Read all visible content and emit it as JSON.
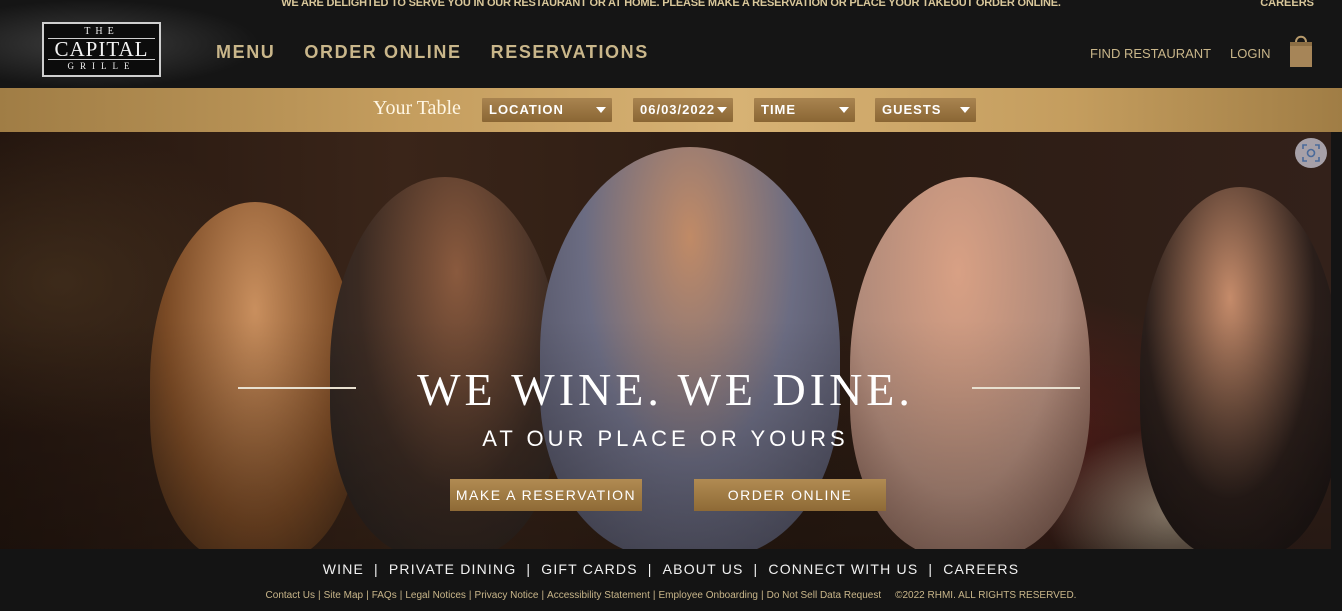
{
  "announcement": "WE ARE DELIGHTED TO SERVE YOU IN OUR RESTAURANT OR AT HOME. PLEASE MAKE A RESERVATION OR PLACE YOUR TAKEOUT ORDER ONLINE.",
  "top_careers": "CAREERS",
  "logo": {
    "the": "THE",
    "capital": "CAPITAL",
    "grille": "GRILLE"
  },
  "nav": [
    {
      "label": "MENU"
    },
    {
      "label": "ORDER ONLINE"
    },
    {
      "label": "RESERVATIONS"
    }
  ],
  "header_links": {
    "find": "FIND RESTAURANT",
    "login": "LOGIN",
    "bag_icon": "shopping-bag-icon"
  },
  "reservation": {
    "title": "Your Table",
    "location": "LOCATION",
    "date": "06/03/2022",
    "time": "TIME",
    "guests": "GUESTS"
  },
  "hero": {
    "headline": "WE WINE. WE DINE.",
    "subhead": "AT OUR PLACE OR YOURS",
    "btn_reserve": "MAKE A RESERVATION",
    "btn_order": "ORDER ONLINE",
    "scan_icon": "visual-search-icon"
  },
  "footer_nav": [
    {
      "label": "WINE"
    },
    {
      "label": "PRIVATE DINING"
    },
    {
      "label": "GIFT CARDS"
    },
    {
      "label": "ABOUT US"
    },
    {
      "label": "CONNECT WITH US"
    },
    {
      "label": "CAREERS"
    }
  ],
  "footer_links": [
    {
      "label": "Contact Us"
    },
    {
      "label": "Site Map"
    },
    {
      "label": "FAQs"
    },
    {
      "label": "Legal Notices"
    },
    {
      "label": "Privacy Notice"
    },
    {
      "label": "Accessibility Statement"
    },
    {
      "label": "Employee Onboarding"
    },
    {
      "label": "Do Not Sell Data Request"
    }
  ],
  "copyright": "©2022 RHMI. ALL RIGHTS RESERVED.",
  "colors": {
    "gold": "#c9b68a",
    "bar_gold": "#c49d5e",
    "dark": "#141414"
  }
}
